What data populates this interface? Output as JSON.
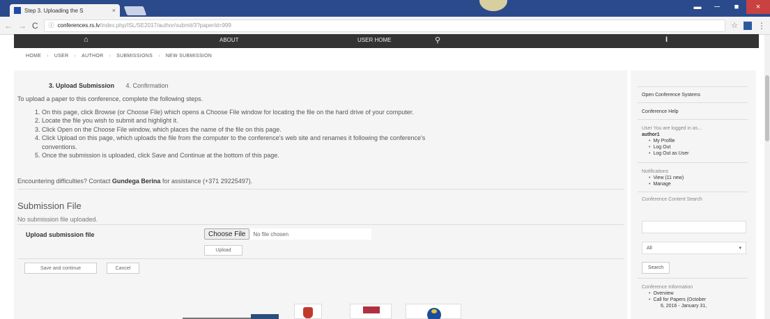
{
  "browser": {
    "tab_title": "Step 3. Uploading the S",
    "tab_close": "×",
    "url_domain": "conferences.rs.lv",
    "url_rest": "/index.php/ISL/SE2017/author/submit/3?paperId=999",
    "window_controls": [
      "▬",
      "─",
      "■",
      "×"
    ]
  },
  "sitenav": {
    "about": "ABOUT",
    "user_home": "USER HOME"
  },
  "breadcrumb": [
    "HOME",
    "USER",
    "AUTHOR",
    "SUBMISSIONS",
    "NEW SUBMISSION"
  ],
  "steps": {
    "active": "3. Upload Submission",
    "next": "4. Confirmation"
  },
  "intro": "To upload a paper to this conference, complete the following steps.",
  "instructions": [
    "1. On this page, click Browse (or Choose File) which opens a Choose File window for locating the file on the hard drive of your computer.",
    "2. Locate the file you wish to submit and highlight it.",
    "3. Click Open on the Choose File window, which places the name of the file on this page.",
    "4. Click Upload on this page, which uploads the file from the computer to the conference's web site and renames it following the conference's",
    "   conventions.",
    "5. Once the submission is uploaded, click Save and Continue at the bottom of this page."
  ],
  "difficulty": {
    "before": "Encountering difficulties? Contact ",
    "contact": "Gundega Berina",
    "after": " for assistance (+371 29225497)."
  },
  "submission": {
    "title": "Submission File",
    "no_file": "No submission file uploaded.",
    "upload_label": "Upload submission file",
    "choose_file_label": "Choose File",
    "no_file_chosen": "No file chosen",
    "upload_button": "Upload",
    "save_button": "Save and continue",
    "cancel_button": "Cancel"
  },
  "sidebar": {
    "ocs": "Open Conference Systems",
    "help": "Conference Help",
    "logged_in": "User You are logged in as...",
    "username": "author1",
    "user_links": [
      "My Profile",
      "Log Out",
      "Log Out as User"
    ],
    "notifications_heading": "Notifications",
    "notification_links": [
      "View (11 new)",
      "Manage"
    ],
    "search_heading": "Conference Content Search",
    "select_value": "All",
    "search_button": "Search",
    "info_heading": "Conference Information",
    "info_links": [
      "Overview",
      "Call for Papers (October",
      "6, 2016 - January 31,"
    ]
  }
}
